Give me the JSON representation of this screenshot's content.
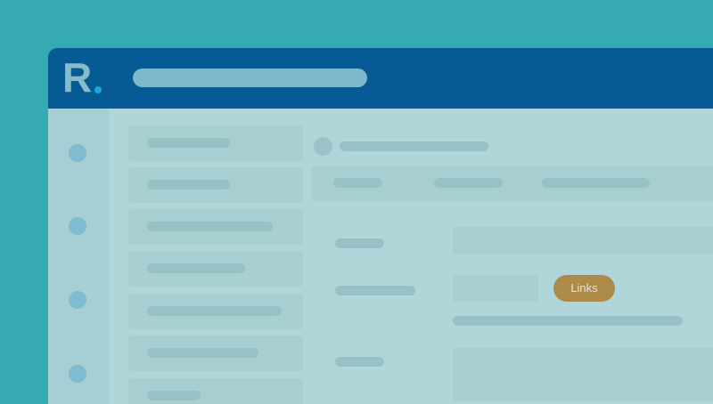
{
  "logo": {
    "text": "R"
  },
  "form": {
    "links_button_label": "Links"
  },
  "colors": {
    "background": "#33abb0",
    "header": "#065b95",
    "logo_dot": "#19a7df",
    "accent_button": "#ad8a4a"
  }
}
